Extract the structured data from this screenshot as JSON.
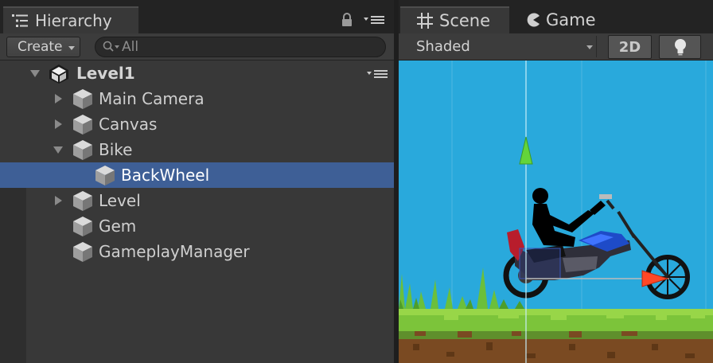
{
  "hierarchy": {
    "tab_label": "Hierarchy",
    "create_label": "Create",
    "search_placeholder": "All",
    "scene_name": "Level1",
    "items": [
      {
        "label": "Main Camera"
      },
      {
        "label": "Canvas"
      },
      {
        "label": "Bike"
      },
      {
        "label": "BackWheel"
      },
      {
        "label": "Level"
      },
      {
        "label": "Gem"
      },
      {
        "label": "GameplayManager"
      }
    ]
  },
  "scene_view": {
    "scene_tab_label": "Scene",
    "game_tab_label": "Game",
    "shading_mode": "Shaded",
    "mode_2d_label": "2D"
  },
  "colors": {
    "selection": "#3e5f96",
    "sky": "#29a9dc",
    "grass": "#7cc43a",
    "dirt": "#7a4a22"
  }
}
